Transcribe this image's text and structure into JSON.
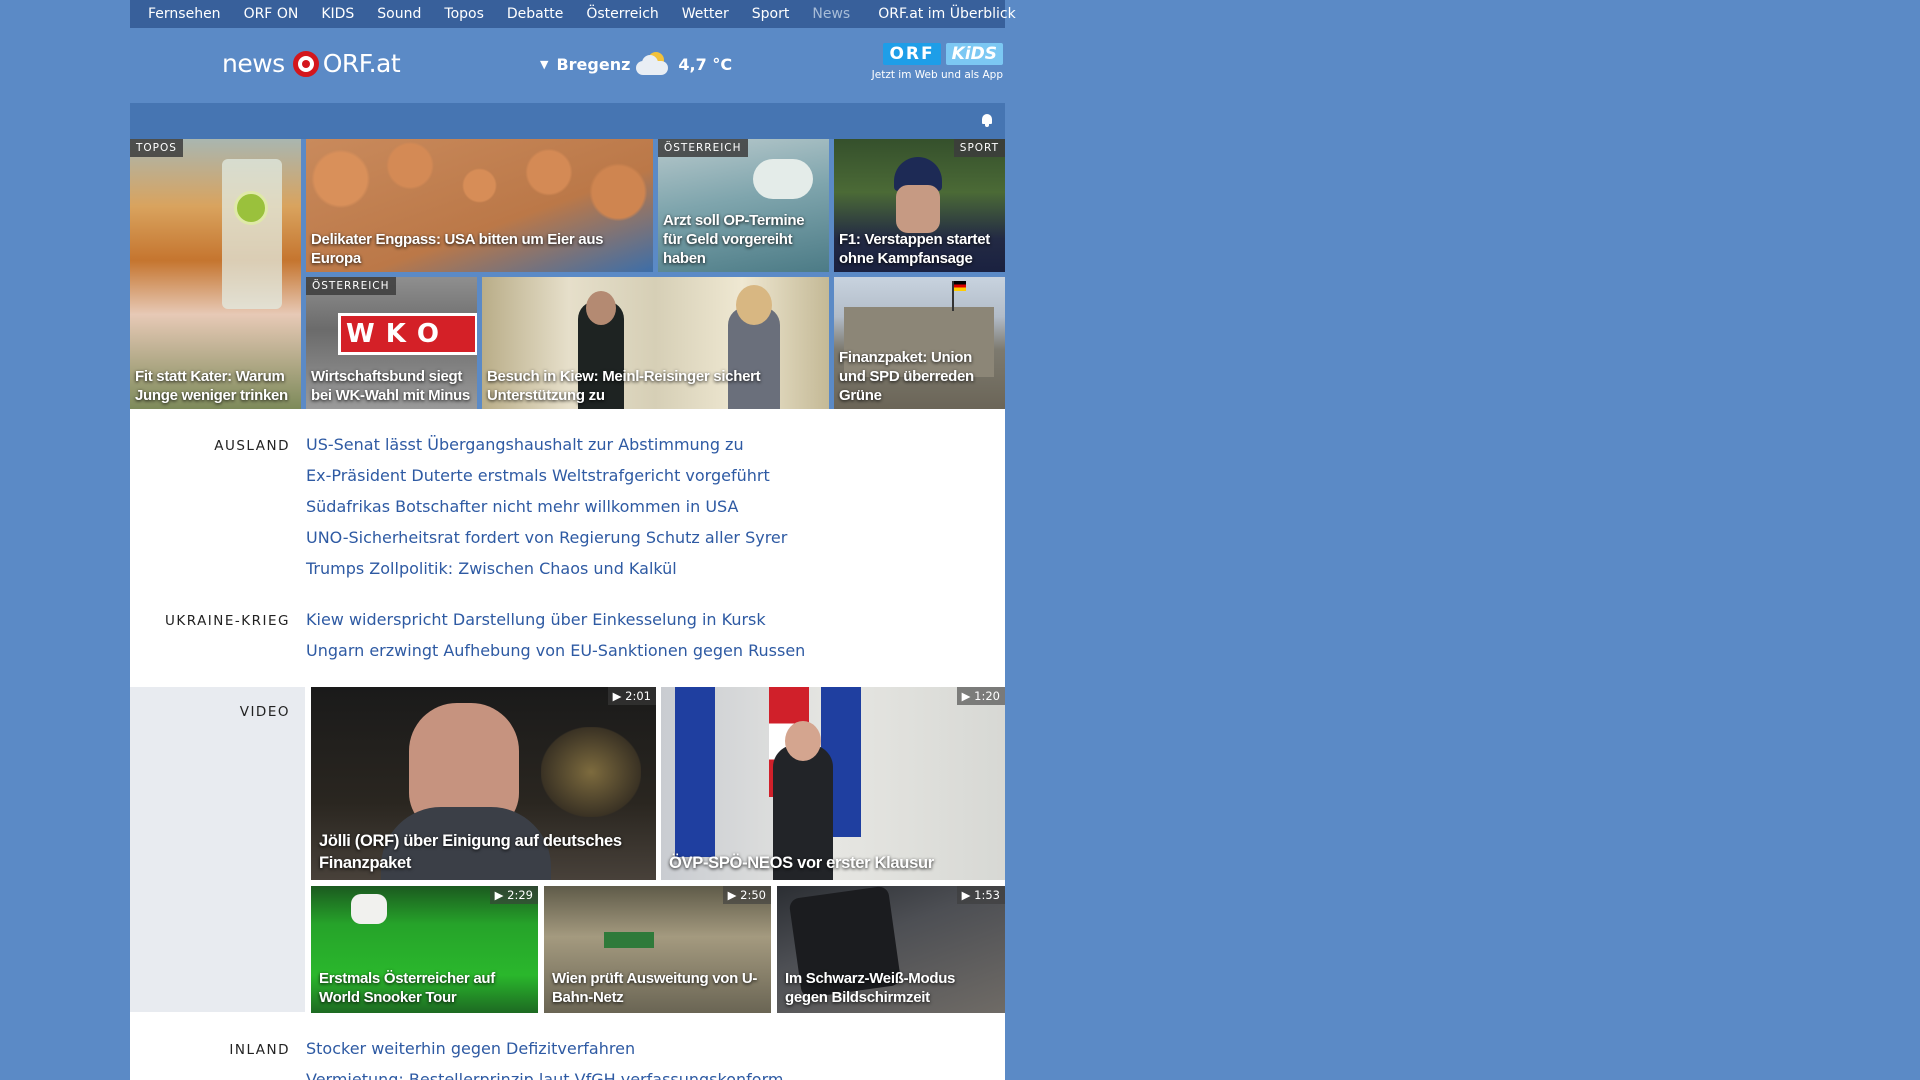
{
  "nav": {
    "items": [
      "Fernsehen",
      "ORF ON",
      "KIDS",
      "Sound",
      "Topos",
      "Debatte",
      "Österreich",
      "Wetter",
      "Sport",
      "News"
    ],
    "overview": "ORF.at im Überblick"
  },
  "header": {
    "logo_news": "news",
    "logo_orf": "ORF.at",
    "weather_city": "Bregenz",
    "weather_temp": "4,7 °C",
    "weather_icon": "partly-cloudy-icon",
    "kids_orf": "ORF",
    "kids_kids": "KiDS",
    "kids_sub": "Jetzt im Web und als App"
  },
  "tiles": [
    {
      "tag": "TOPOS",
      "caption": "Fit statt Kater: Warum Junge weniger trinken"
    },
    {
      "tag": "",
      "caption": "Delikater Engpass: USA bitten um Eier aus Europa"
    },
    {
      "tag": "ÖSTERREICH",
      "caption": "Arzt soll OP-Termine für Geld vorgereiht haben"
    },
    {
      "tag": "SPORT",
      "caption": "F1: Verstappen startet ohne Kampfansage"
    },
    {
      "tag": "ÖSTERREICH",
      "caption": "Wirtschaftsbund siegt bei WK-Wahl mit Minus"
    },
    {
      "tag": "",
      "caption": "Besuch in Kiew: Meinl-Reisinger sichert Unterstützung zu"
    },
    {
      "tag": "",
      "caption": "Finanzpaket: Union und SPD überreden Grüne"
    }
  ],
  "wko_text": "W K O",
  "sections": {
    "ausland": {
      "label": "AUSLAND",
      "links": [
        "US-Senat lässt Übergangshaushalt zur Abstimmung zu",
        "Ex-Präsident Duterte erstmals Weltstrafgericht vorgeführt",
        "Südafrikas Botschafter nicht mehr willkommen in USA",
        "UNO-Sicherheitsrat fordert von Regierung Schutz aller Syrer",
        "Trumps Zollpolitik: Zwischen Chaos und Kalkül"
      ]
    },
    "ukraine": {
      "label": "UKRAINE-KRIEG",
      "links": [
        "Kiew widerspricht Darstellung über Einkesselung in Kursk",
        "Ungarn erzwingt Aufhebung von EU-Sanktionen gegen Russen"
      ]
    },
    "video": {
      "label": "VIDEO",
      "items": [
        {
          "duration": "2:01",
          "caption": "Jölli (ORF) über Einigung auf deutsches Finanzpaket"
        },
        {
          "duration": "1:20",
          "caption": "ÖVP-SPÖ-NEOS vor erster Klausur"
        },
        {
          "duration": "2:29",
          "caption": "Erstmals Österreicher auf World Snooker Tour"
        },
        {
          "duration": "2:50",
          "caption": "Wien prüft Ausweitung von U-Bahn-Netz"
        },
        {
          "duration": "1:53",
          "caption": "Im Schwarz-Weiß-Modus gegen Bildschirmzeit"
        }
      ]
    },
    "inland": {
      "label": "INLAND",
      "links": [
        "Stocker weiterhin gegen Defizitverfahren",
        "Vermietung: Bestellerprinzip laut VfGH verfassungskonform"
      ]
    }
  },
  "colors": {
    "background": "#5b8ac6",
    "nav_bg": "#38609b",
    "link": "#2e5aa3",
    "orf_red": "#d4161c"
  }
}
